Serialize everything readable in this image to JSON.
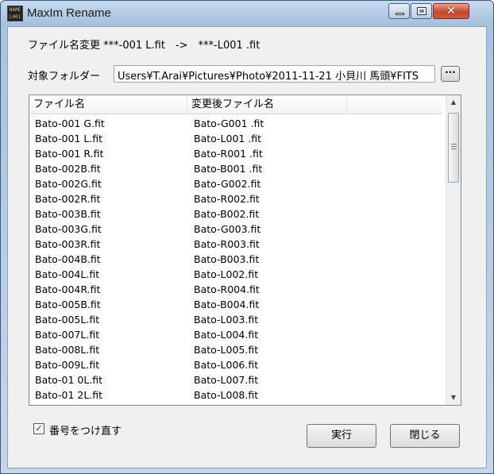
{
  "window": {
    "title": "MaxIm Rename",
    "icon_text": "NAME\nL001",
    "controls": {
      "minimize": "—",
      "maximize": "□",
      "close": "✕"
    }
  },
  "rename_rule": "ファイル名変更 ***-001 L.fit　->　***-L001 .fit",
  "folder": {
    "label": "対象フォルダー",
    "value": "Users¥T.Arai¥Pictures¥Photo¥2011-11-21 小貝川 馬頭¥FITS",
    "browse_label": "···"
  },
  "list": {
    "columns": [
      "ファイル名",
      "変更後ファイル名"
    ],
    "rows": [
      [
        "Bato-001 G.fit",
        "Bato-G001 .fit"
      ],
      [
        "Bato-001 L.fit",
        "Bato-L001 .fit"
      ],
      [
        "Bato-001 R.fit",
        "Bato-R001 .fit"
      ],
      [
        "Bato-002B.fit",
        "Bato-B001 .fit"
      ],
      [
        "Bato-002G.fit",
        "Bato-G002.fit"
      ],
      [
        "Bato-002R.fit",
        "Bato-R002.fit"
      ],
      [
        "Bato-003B.fit",
        "Bato-B002.fit"
      ],
      [
        "Bato-003G.fit",
        "Bato-G003.fit"
      ],
      [
        "Bato-003R.fit",
        "Bato-R003.fit"
      ],
      [
        "Bato-004B.fit",
        "Bato-B003.fit"
      ],
      [
        "Bato-004L.fit",
        "Bato-L002.fit"
      ],
      [
        "Bato-004R.fit",
        "Bato-R004.fit"
      ],
      [
        "Bato-005B.fit",
        "Bato-B004.fit"
      ],
      [
        "Bato-005L.fit",
        "Bato-L003.fit"
      ],
      [
        "Bato-007L.fit",
        "Bato-L004.fit"
      ],
      [
        "Bato-008L.fit",
        "Bato-L005.fit"
      ],
      [
        "Bato-009L.fit",
        "Bato-L006.fit"
      ],
      [
        "Bato-01 0L.fit",
        "Bato-L007.fit"
      ],
      [
        "Bato-01 2L.fit",
        "Bato-L008.fit"
      ]
    ]
  },
  "renumber": {
    "label": "番号をつけ直す",
    "checked": true,
    "check_glyph": "✓"
  },
  "buttons": {
    "execute": "実行",
    "close": "閉じる"
  },
  "scroll": {
    "up": "▲",
    "down": "▼"
  }
}
